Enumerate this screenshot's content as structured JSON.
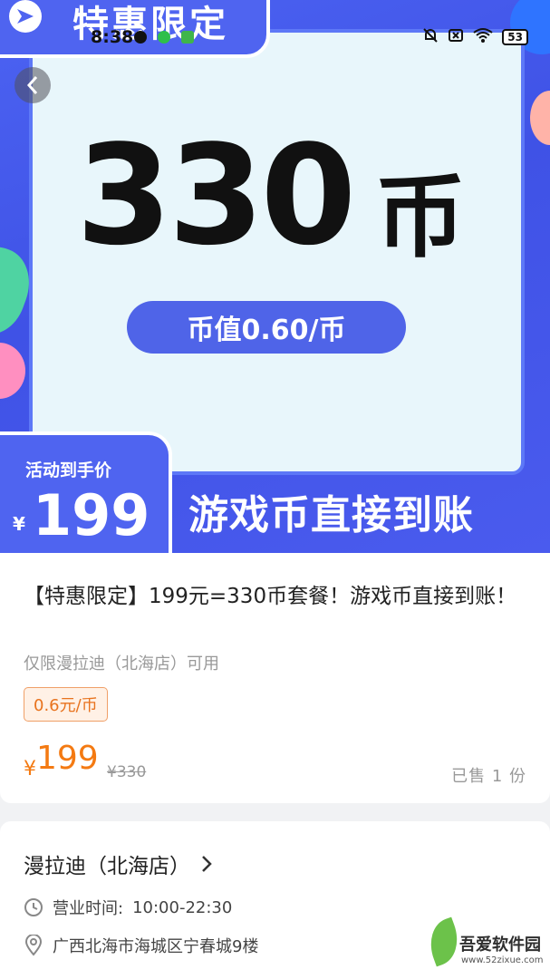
{
  "status_bar": {
    "time": "8:38",
    "battery": "53"
  },
  "banner": {
    "tag_title": "特惠限定",
    "big_number": "330",
    "big_unit": "币",
    "coin_value": "币值0.60/币",
    "price_label": "活动到手价",
    "price_currency": "¥",
    "price_value": "199",
    "slogan": "游戏币直接到账",
    "colors": {
      "primary": "#4f64f0",
      "panel": "#e8f6fb",
      "green_deco": "#4fd3a2",
      "pink_deco": "#ff8fc0"
    }
  },
  "product": {
    "title": "【特惠限定】199元=330币套餐！游戏币直接到账！",
    "availability": "仅限漫拉迪（北海店）可用",
    "rate_badge": "0.6元/币",
    "currency": "¥",
    "price": "199",
    "original_price": "¥330",
    "sold": "已售 1 份",
    "accent_color": "#f47a12"
  },
  "store": {
    "name": "漫拉迪（北海店）",
    "hours_label": "营业时间:",
    "hours_value": "10:00-22:30",
    "address": "广西北海市海城区宁春城9楼"
  },
  "watermark": {
    "text": "吾爱软件园",
    "url": "www.52zixue.com"
  }
}
